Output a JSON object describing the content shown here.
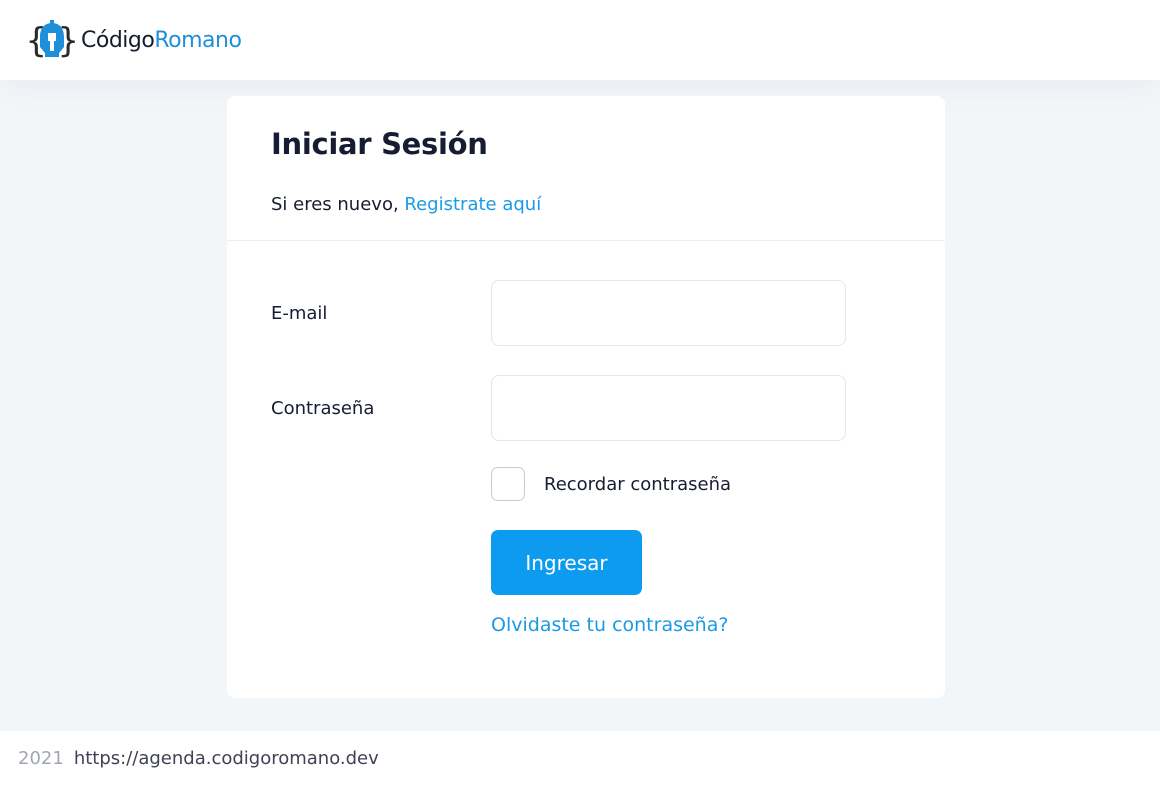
{
  "header": {
    "logo_part1": "Código",
    "logo_part2": "Romano",
    "logo_icon": "spartan-helmet-icon"
  },
  "login": {
    "title": "Iniciar Sesión",
    "subtitle_text": "Si eres nuevo, ",
    "register_link": "Registrate aquí",
    "email_label": "E-mail",
    "email_value": "",
    "password_label": "Contraseña",
    "password_value": "",
    "remember_label": "Recordar contraseña",
    "remember_checked": false,
    "submit_label": "Ingresar",
    "forgot_link": "Olvidaste tu contraseña?"
  },
  "footer": {
    "year": "2021",
    "url": "https://agenda.codigoromano.dev"
  },
  "colors": {
    "primary": "#0d9bf0",
    "link": "#1a9ae6",
    "background": "#f3f6f9",
    "text": "#181c32"
  }
}
